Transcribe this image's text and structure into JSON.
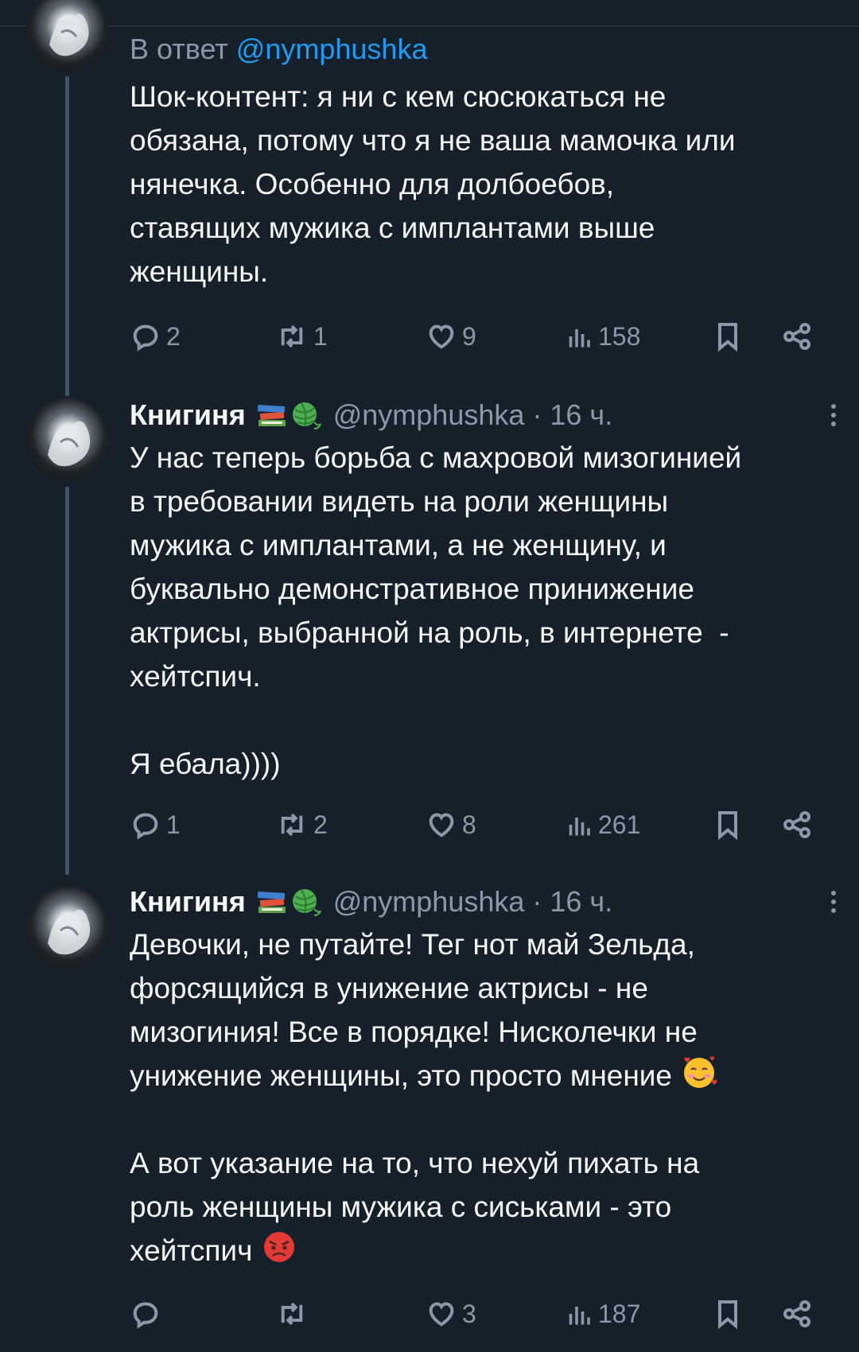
{
  "tweets": [
    {
      "reply_to_prefix": "В ответ",
      "reply_to_handle": "@nymphushka",
      "text": "Шок-контент: я ни с кем сюсюкаться не\nобязана, потому что я не ваша мамочка или\nнянечка. Особенно для долбоебов,\nставящих мужика с имплантами выше\nженщины.",
      "replies": "2",
      "reposts": "1",
      "likes": "9",
      "views": "158"
    },
    {
      "name": "Книгиня",
      "name_emoji": [
        "books-emoji",
        "yarn-emoji"
      ],
      "handle_time": "@nymphushka · 16 ч.",
      "text": "У нас теперь борьба с махровой мизогинией\nв требовании видеть на роли женщины\nмужика с имплантами, а не женщину, и\nбуквально демонстративное принижение\nактрисы, выбранной на роль, в интернете  -\nхейтспич.\n\nЯ ебала))))",
      "replies": "1",
      "reposts": "2",
      "likes": "8",
      "views": "261"
    },
    {
      "name": "Книгиня",
      "name_emoji": [
        "books-emoji",
        "yarn-emoji"
      ],
      "handle_time": "@nymphushka · 16 ч.",
      "text_part1": "Девочки, не путайте! Тег нот май Зельда,\nфорсящийся в унижение актрисы - не\nмизогиния! Все в порядке! Нисколечки не\nунижение женщины, это просто мнение ",
      "text_part2": "\n\nА вот указание на то, что нехуй пихать на\nроль женщины мужика с сиськами - это\nхейтспич ",
      "emoji1": "smiling-face-with-hearts-emoji",
      "emoji2": "angry-face-emoji",
      "replies": "",
      "reposts": "",
      "likes": "3",
      "views": "187"
    }
  ],
  "colors": {
    "background": "#15202b",
    "text": "#f7f9f9",
    "muted": "#8b98a5",
    "link": "#1d9bf0"
  }
}
